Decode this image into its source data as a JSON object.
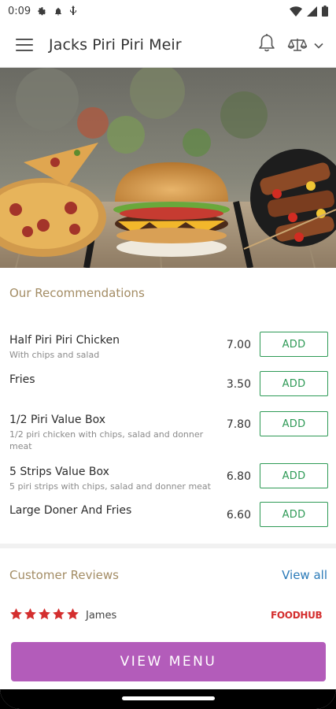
{
  "status_bar": {
    "time": "0:09",
    "icons": [
      "gear-icon",
      "notification-bell-icon",
      "usb-icon",
      "wifi-icon",
      "signal-icon",
      "battery-icon"
    ]
  },
  "app_bar": {
    "title": "Jacks Piri Piri Meir",
    "icons": [
      "menu-icon",
      "bell-icon",
      "scale-icon",
      "chevron-down-icon"
    ]
  },
  "hero": {
    "description_icons": [
      "pizza",
      "burger",
      "kebab-skewers"
    ]
  },
  "recommendations": {
    "title": "Our Recommendations",
    "add_label": "ADD",
    "items": [
      {
        "name": "Half Piri Piri Chicken",
        "description": "With chips and salad",
        "price": "7.00"
      },
      {
        "name": "Fries",
        "description": "",
        "price": "3.50"
      },
      {
        "name": "1/2 Piri Value Box",
        "description": "1/2 piri chicken with chips, salad and donner meat",
        "price": "7.80"
      },
      {
        "name": "5 Strips Value Box",
        "description": "5 piri strips with chips, salad and donner meat",
        "price": "6.80"
      },
      {
        "name": "Large Doner And Fries",
        "description": "",
        "price": "6.60"
      }
    ]
  },
  "reviews": {
    "title": "Customer Reviews",
    "view_all": "View all",
    "rating": 5,
    "reviewer": "James",
    "source": "FOODHUB"
  },
  "cta": {
    "label": "VIEW MENU"
  },
  "colors": {
    "accent_purple": "#b35cba",
    "add_green": "#2e9a56",
    "section_gold": "#a38c64",
    "link_blue": "#2a7ab8",
    "star_red": "#d42e2e"
  }
}
